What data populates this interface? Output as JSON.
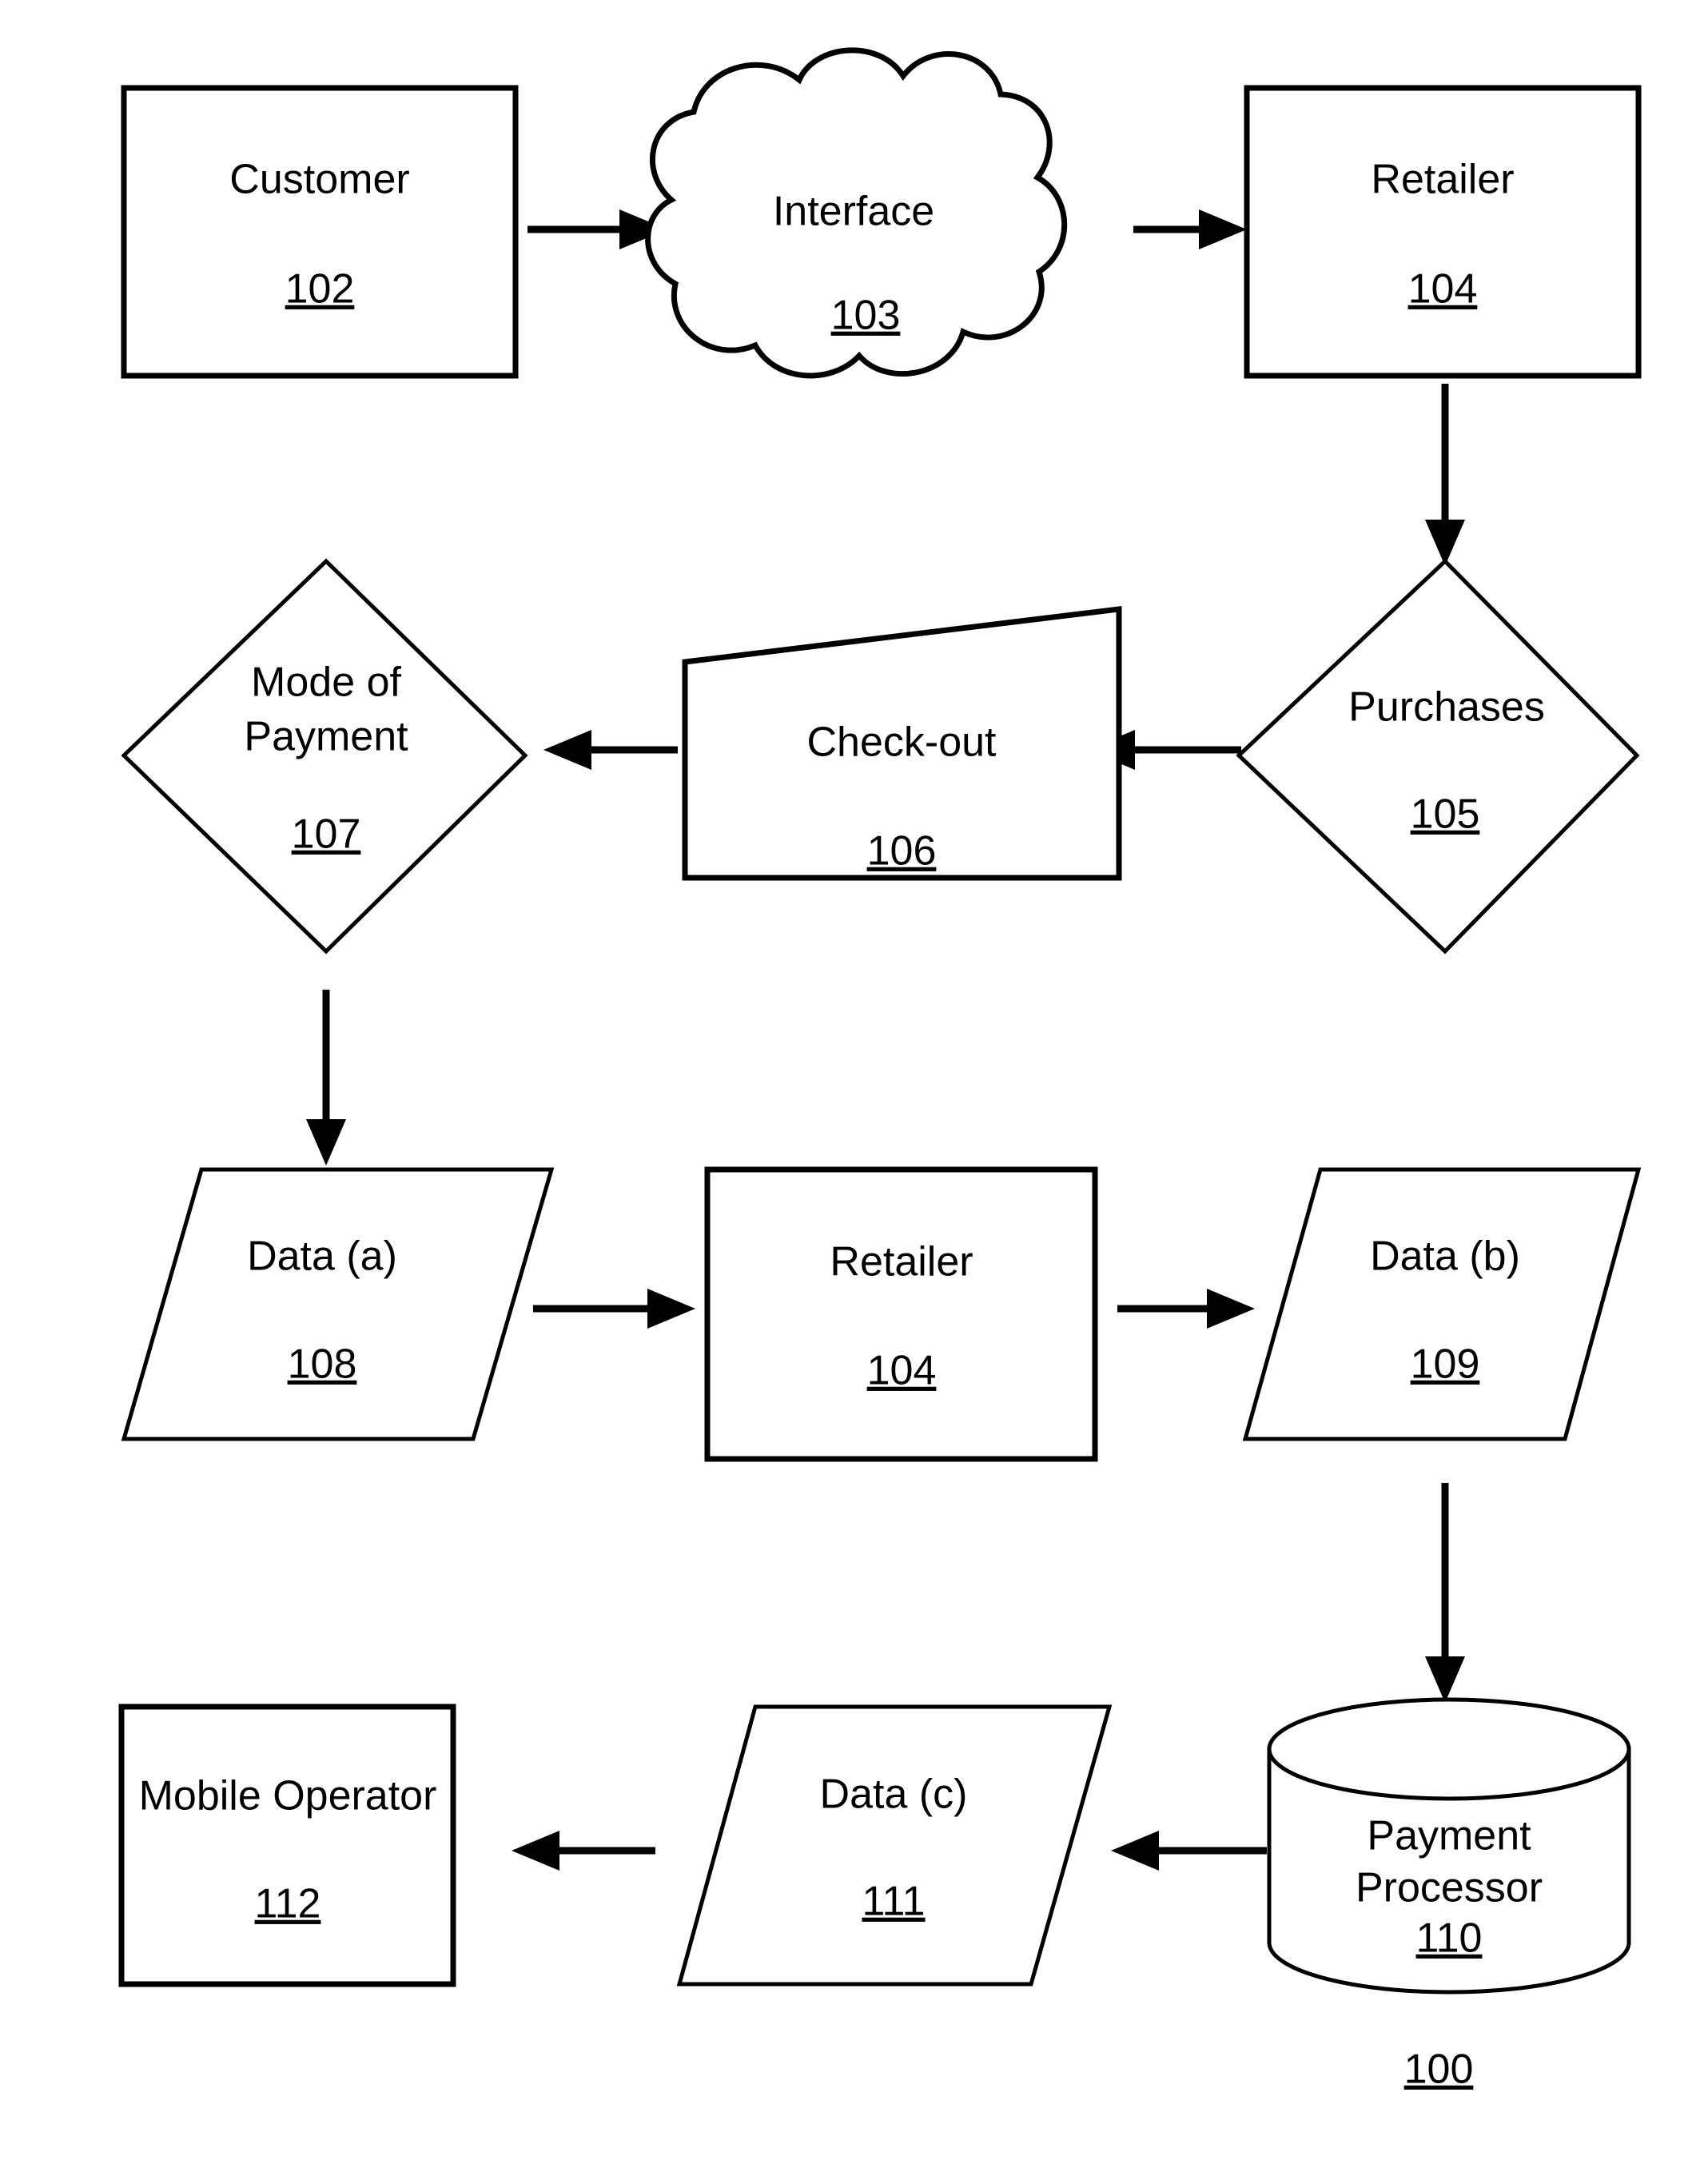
{
  "figure": {
    "reference_numeral": "100",
    "background_color": "#ffffff",
    "line_color": "#000000"
  },
  "nodes": {
    "customer": {
      "label": "Customer",
      "ref": "102",
      "shape": "rectangle"
    },
    "interface": {
      "label": "Interface",
      "ref": "103",
      "shape": "cloud"
    },
    "retailer_top": {
      "label": "Retailer",
      "ref": "104",
      "shape": "rectangle"
    },
    "purchases": {
      "label": "Purchases",
      "ref": "105",
      "shape": "diamond"
    },
    "checkout": {
      "label": "Check-out",
      "ref": "106",
      "shape": "quadrilateral"
    },
    "mode_of_payment": {
      "label_line1": "Mode of",
      "label_line2": "Payment",
      "ref": "107",
      "shape": "diamond"
    },
    "data_a": {
      "label": "Data (a)",
      "ref": "108",
      "shape": "parallelogram"
    },
    "retailer_mid": {
      "label": "Retailer",
      "ref": "104",
      "shape": "rectangle"
    },
    "data_b": {
      "label": "Data (b)",
      "ref": "109",
      "shape": "parallelogram"
    },
    "payment_processor": {
      "label_line1": "Payment",
      "label_line2": "Processor",
      "ref": "110",
      "shape": "cylinder"
    },
    "data_c": {
      "label": "Data (c)",
      "ref": "111",
      "shape": "parallelogram"
    },
    "mobile_operator": {
      "label": "Mobile Operator",
      "ref": "112",
      "shape": "rectangle"
    }
  },
  "connectors": [
    {
      "name": "customer-to-interface",
      "from": "customer",
      "to": "interface",
      "direction": "right"
    },
    {
      "name": "interface-to-retailer-top",
      "from": "interface",
      "to": "retailer_top",
      "direction": "right"
    },
    {
      "name": "retailer-top-to-purchases",
      "from": "retailer_top",
      "to": "purchases",
      "direction": "down"
    },
    {
      "name": "purchases-to-checkout",
      "from": "purchases",
      "to": "checkout",
      "direction": "left"
    },
    {
      "name": "checkout-to-mode-of-payment",
      "from": "checkout",
      "to": "mode_of_payment",
      "direction": "left"
    },
    {
      "name": "mode-of-payment-to-data-a",
      "from": "mode_of_payment",
      "to": "data_a",
      "direction": "down"
    },
    {
      "name": "data-a-to-retailer-mid",
      "from": "data_a",
      "to": "retailer_mid",
      "direction": "right"
    },
    {
      "name": "retailer-mid-to-data-b",
      "from": "retailer_mid",
      "to": "data_b",
      "direction": "right"
    },
    {
      "name": "data-b-to-payment-processor",
      "from": "data_b",
      "to": "payment_processor",
      "direction": "down"
    },
    {
      "name": "payment-processor-to-data-c",
      "from": "payment_processor",
      "to": "data_c",
      "direction": "left"
    },
    {
      "name": "data-c-to-mobile-operator",
      "from": "data_c",
      "to": "mobile_operator",
      "direction": "left"
    }
  ]
}
